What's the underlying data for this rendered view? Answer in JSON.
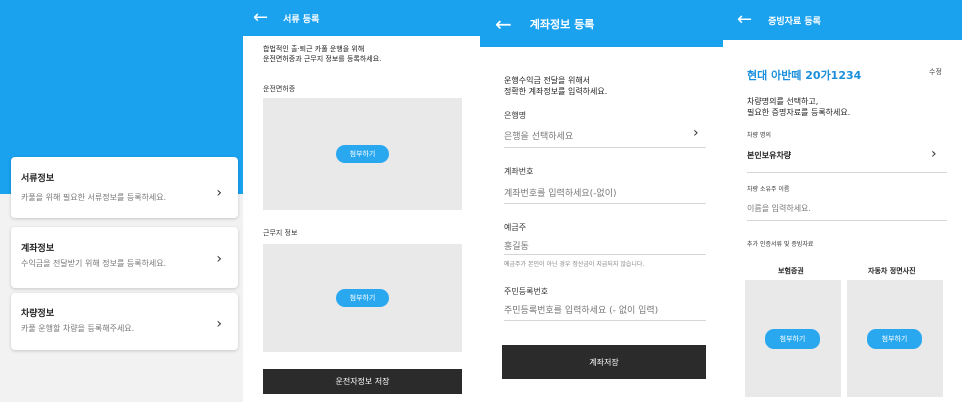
{
  "colors": {
    "accent": "#1aa2ef",
    "dark_button": "#2b2b2b",
    "upload_box": "#e9e9e9"
  },
  "panel1": {
    "cards": [
      {
        "title": "서류정보",
        "desc": "카풀을 위해 필요한 서류정보를 등록하세요."
      },
      {
        "title": "계좌정보",
        "desc": "수익금을 전달받기 위해 정보를 등록하세요."
      },
      {
        "title": "차량정보",
        "desc": "카풀 운행할 차량을 등록해주세요."
      }
    ],
    "chevron": "›"
  },
  "panel2": {
    "back": "←",
    "title": "서류 등록",
    "intro_line1": "합법적인 출·퇴근 카풀 운행을 위해",
    "intro_line2": "운전면허증과 근무지 정보를 등록하세요.",
    "license_label": "운전면허증",
    "workplace_label": "근무지 정보",
    "attach": "첨부하기",
    "save": "운전자정보 저장"
  },
  "panel3": {
    "back": "←",
    "title": "계좌정보 등록",
    "intro_line1": "운행수익금 전달을 위해서",
    "intro_line2": "정확한 계좌정보를 입력하세요.",
    "bank_label": "은행명",
    "bank_placeholder": "은행을 선택하세요",
    "chevron": "›",
    "account_label": "계좌번호",
    "account_placeholder": "계좌번호를 입력하세요(-없이)",
    "holder_label": "예금주",
    "holder_value": "홍길동",
    "holder_note": "예금주가 본인이 아닌 경우 정산금이 지급되지 않습니다.",
    "rrn_label": "주민등록번호",
    "rrn_placeholder": "주민등록번호를 입력하세요 (- 없이 입력)",
    "save": "계좌저장"
  },
  "panel4": {
    "back": "←",
    "title": "증빙자료 등록",
    "plate": "현대 아반떼 20가1234",
    "edit": "수정",
    "intro_line1": "차량명의를 선택하고,",
    "intro_line2": "필요한 증명자료를 등록하세요.",
    "ownership_label": "차량 명의",
    "ownership_value": "본인보유차량",
    "chevron": "›",
    "owner_name_label": "차량 소유주 이름",
    "owner_name_placeholder": "이름을 입력하세요.",
    "extra_docs_label": "추가 인증서류 및 증빙자료",
    "doc1_title": "보험증권",
    "doc2_title": "자동차 정면사진",
    "attach": "첨부하기"
  }
}
